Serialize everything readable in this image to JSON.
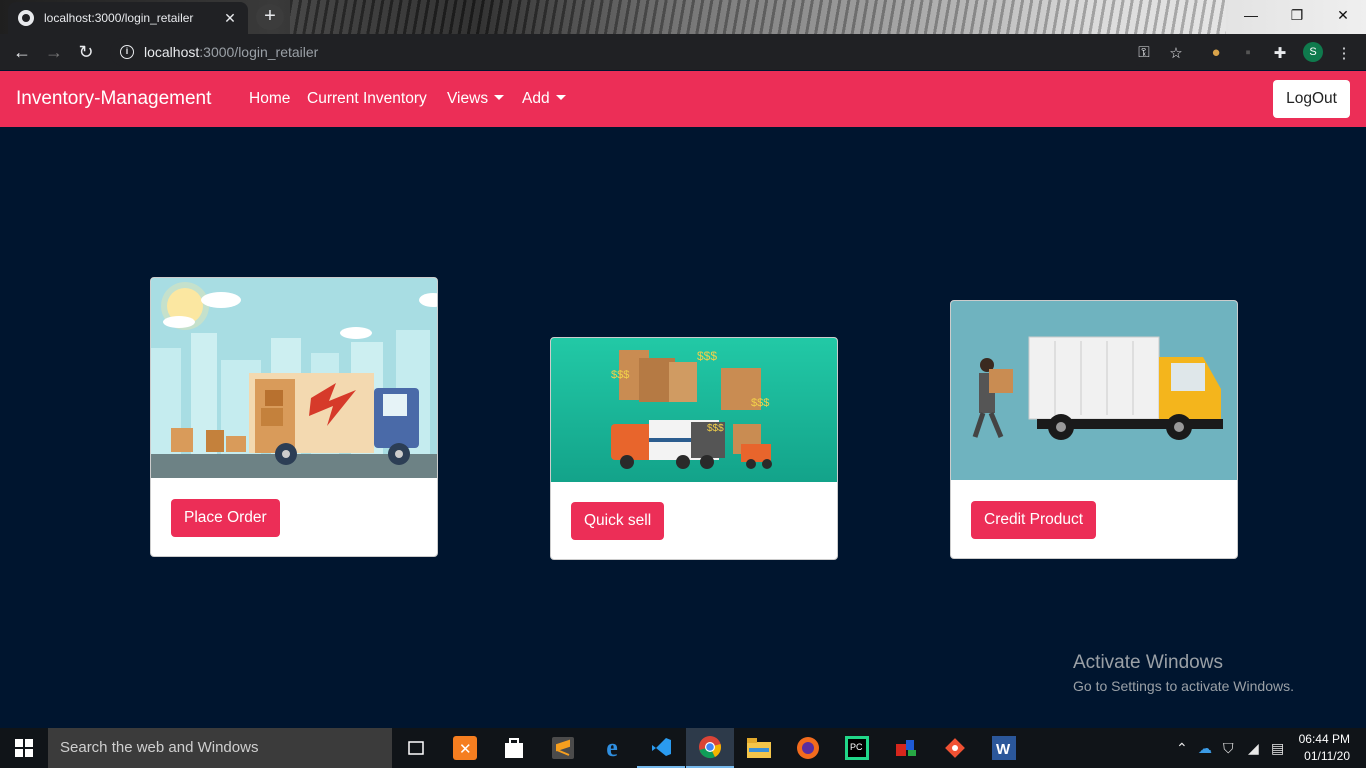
{
  "browser": {
    "tab_title": "localhost:3000/login_retailer",
    "url_host": "localhost",
    "url_path": ":3000/login_retailer",
    "avatar_letter": "S"
  },
  "navbar": {
    "brand": "Inventory-Management",
    "links": [
      "Home",
      "Current Inventory",
      "Views",
      "Add"
    ],
    "logout": "LogOut",
    "bg_color": "#ec2e57"
  },
  "cards": [
    {
      "button": "Place Order",
      "image": "moving-truck-city-illustration"
    },
    {
      "button": "Quick sell",
      "image": "trucks-boxes-dollar-illustration"
    },
    {
      "button": "Credit Product",
      "image": "delivery-man-truck-illustration"
    }
  ],
  "watermark": {
    "line1": "Activate Windows",
    "line2": "Go to Settings to activate Windows."
  },
  "taskbar": {
    "search_placeholder": "Search the web and Windows",
    "time": "06:44 PM",
    "date": "01/11/20"
  }
}
